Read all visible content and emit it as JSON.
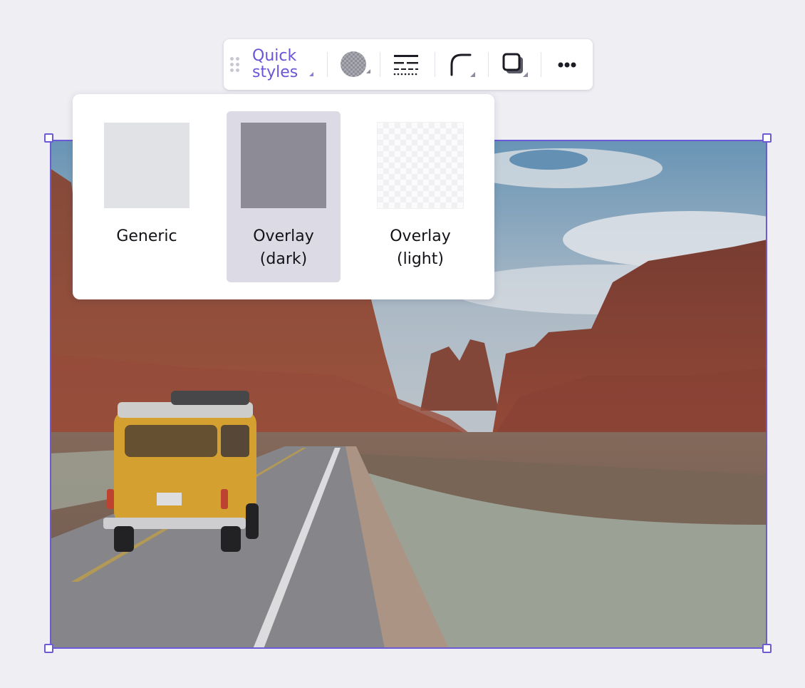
{
  "toolbar": {
    "quick_styles_line1": "Quick",
    "quick_styles_line2": "styles",
    "buttons": [
      {
        "name": "fill-color",
        "icon": "checkerboard-fill-icon"
      },
      {
        "name": "border-style",
        "icon": "border-style-icon"
      },
      {
        "name": "corner-radius",
        "icon": "corner-radius-icon"
      },
      {
        "name": "shadow",
        "icon": "shadow-icon"
      },
      {
        "name": "more",
        "icon": "more-horizontal-icon"
      }
    ],
    "accent_color": "#6a55d9"
  },
  "quick_styles": {
    "options": [
      {
        "line1": "Generic",
        "line2": "",
        "swatch_color": "#e1e2e6",
        "selected": false
      },
      {
        "line1": "Overlay",
        "line2": "(dark)",
        "swatch_color": "#8c8b96",
        "selected": true
      },
      {
        "line1": "Overlay",
        "line2": "(light)",
        "swatch_color": "#fbfbfc",
        "selected": false
      }
    ]
  },
  "canvas": {
    "image_subject": "yellow van on desert road with red rock formations",
    "selection_color": "#6b5bd6"
  }
}
